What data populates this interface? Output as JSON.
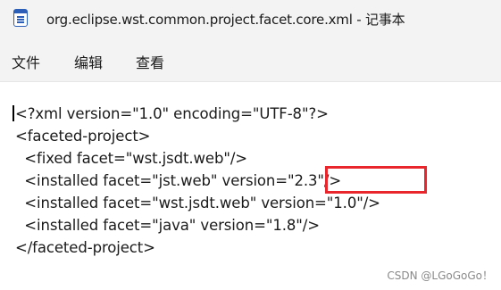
{
  "window": {
    "title": "org.eclipse.wst.common.project.facet.core.xml - 记事本",
    "icon": "notepad-icon"
  },
  "menu": {
    "items": [
      "文件",
      "编辑",
      "查看"
    ]
  },
  "editor": {
    "lines": [
      "<?xml version=\"1.0\" encoding=\"UTF-8\"?>",
      "<faceted-project>",
      "  <fixed facet=\"wst.jsdt.web\"/>",
      "  <installed facet=\"jst.web\" version=\"2.3\"/>",
      "  <installed facet=\"wst.jsdt.web\" version=\"1.0\"/>",
      "  <installed facet=\"java\" version=\"1.8\"/>",
      "</faceted-project>"
    ],
    "highlight_color": "#e8262c"
  },
  "watermark": "CSDN @LGoGoGo！"
}
